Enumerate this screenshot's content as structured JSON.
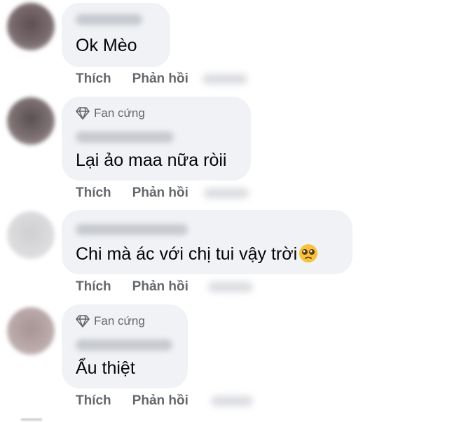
{
  "badge_label": "Fan cứng",
  "actions": {
    "like": "Thích",
    "reply": "Phản hồi"
  },
  "comments": [
    {
      "text": "Ok Mèo",
      "has_badge": false
    },
    {
      "text": "Lại ảo maa nữa ròii",
      "has_badge": true
    },
    {
      "text": "Chi mà ác với chị tui vậy trời",
      "has_badge": false,
      "trailing_emoji": "pleading-face-emoji"
    },
    {
      "text": "Ẩu thiệt",
      "has_badge": true
    }
  ],
  "colors": {
    "bubble": "#f0f2f5",
    "text": "#050505",
    "secondary_text": "#65676b"
  }
}
